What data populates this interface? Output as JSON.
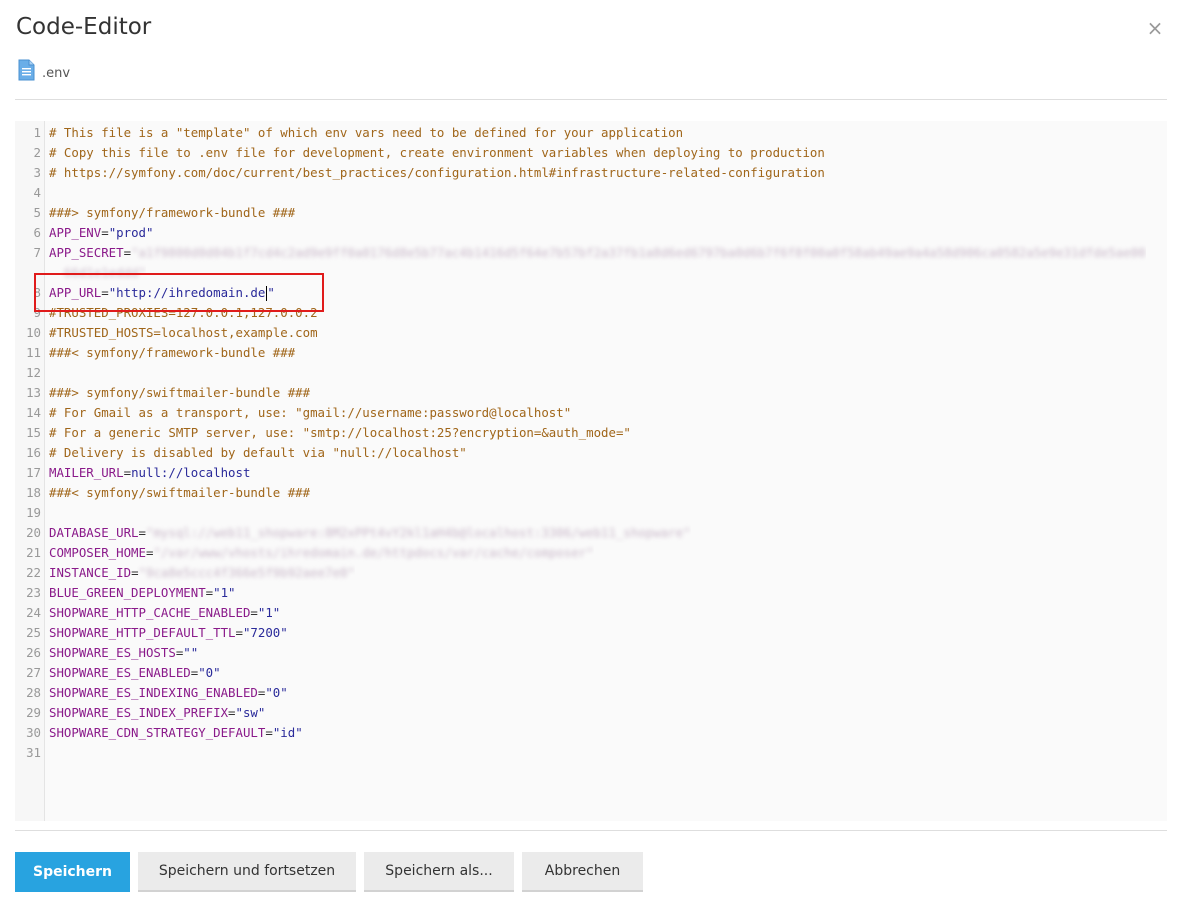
{
  "dialog": {
    "title": "Code-Editor",
    "close_glyph": "×",
    "file_name": ".env"
  },
  "editor": {
    "lines": [
      {
        "n": "1",
        "parts": [
          {
            "t": "# This file is a \"template\" of which env vars need to be defined for your application",
            "c": "cmt"
          }
        ]
      },
      {
        "n": "2",
        "parts": [
          {
            "t": "# Copy this file to .env file for development, create environment variables when deploying to production",
            "c": "cmt"
          }
        ]
      },
      {
        "n": "3",
        "parts": [
          {
            "t": "# https://symfony.com/doc/current/best_practices/configuration.html#infrastructure-related-configuration",
            "c": "cmt"
          }
        ]
      },
      {
        "n": "4",
        "parts": []
      },
      {
        "n": "5",
        "parts": [
          {
            "t": "###> symfony/framework-bundle ###",
            "c": "cmt"
          }
        ]
      },
      {
        "n": "6",
        "parts": [
          {
            "t": "APP_ENV",
            "c": "key"
          },
          {
            "t": "=",
            "c": "eq"
          },
          {
            "t": "\"prod\"",
            "c": "str"
          }
        ]
      },
      {
        "n": "7",
        "parts": [
          {
            "t": "APP_SECRET",
            "c": "key"
          },
          {
            "t": "=",
            "c": "eq"
          },
          {
            "t": "\"a1f9800d0d04b1f7cd4c2ad9e9ff0a0176d8e5b77ac4b1416d5f64e7b57bf2a37fb1a8d6ed6797ba0d6b7f6f8f00a0f58ab49ae9a4a58d906ca0582a5e9e31dfde5ae00",
            "c": "blur"
          }
        ]
      },
      {
        "n": "",
        "parts": [
          {
            "t": "  66d1e1eddd\"",
            "c": "blur"
          }
        ]
      },
      {
        "n": "8",
        "parts": [
          {
            "t": "APP_URL",
            "c": "key"
          },
          {
            "t": "=",
            "c": "eq"
          },
          {
            "t": "\"http://ihredomain.de",
            "c": "str"
          },
          {
            "t": "|CURSOR|",
            "c": "cursor"
          },
          {
            "t": "\"",
            "c": "str"
          }
        ]
      },
      {
        "n": "9",
        "parts": [
          {
            "t": "#TRUSTED_PROXIES=127.0.0.1,127.0.0.2",
            "c": "cmt"
          }
        ]
      },
      {
        "n": "10",
        "parts": [
          {
            "t": "#TRUSTED_HOSTS=localhost,example.com",
            "c": "cmt"
          }
        ]
      },
      {
        "n": "11",
        "parts": [
          {
            "t": "###< symfony/framework-bundle ###",
            "c": "cmt"
          }
        ]
      },
      {
        "n": "12",
        "parts": []
      },
      {
        "n": "13",
        "parts": [
          {
            "t": "###> symfony/swiftmailer-bundle ###",
            "c": "cmt"
          }
        ]
      },
      {
        "n": "14",
        "parts": [
          {
            "t": "# For Gmail as a transport, use: \"gmail://username:password@localhost\"",
            "c": "cmt"
          }
        ]
      },
      {
        "n": "15",
        "parts": [
          {
            "t": "# For a generic SMTP server, use: \"smtp://localhost:25?encryption=&auth_mode=\"",
            "c": "cmt"
          }
        ]
      },
      {
        "n": "16",
        "parts": [
          {
            "t": "# Delivery is disabled by default via \"null://localhost\"",
            "c": "cmt"
          }
        ]
      },
      {
        "n": "17",
        "parts": [
          {
            "t": "MAILER_URL",
            "c": "key"
          },
          {
            "t": "=",
            "c": "eq"
          },
          {
            "t": "null://localhost",
            "c": "str"
          }
        ]
      },
      {
        "n": "18",
        "parts": [
          {
            "t": "###< symfony/swiftmailer-bundle ###",
            "c": "cmt"
          }
        ]
      },
      {
        "n": "19",
        "parts": []
      },
      {
        "n": "20",
        "parts": [
          {
            "t": "DATABASE_URL",
            "c": "key"
          },
          {
            "t": "=",
            "c": "eq"
          },
          {
            "t": "\"mysql://web11_shopware:8M2xPPt4vY2kl1aH4b@localhost:3306/web11_shopware\"",
            "c": "blur"
          }
        ]
      },
      {
        "n": "21",
        "parts": [
          {
            "t": "COMPOSER_HOME",
            "c": "key"
          },
          {
            "t": "=",
            "c": "eq"
          },
          {
            "t": "\"/var/www/vhosts/ihredomain.de/httpdocs/var/cache/composer\"",
            "c": "blur"
          }
        ]
      },
      {
        "n": "22",
        "parts": [
          {
            "t": "INSTANCE_ID",
            "c": "key"
          },
          {
            "t": "=",
            "c": "eq"
          },
          {
            "t": "\"9ca8e5ccc4f366e5f9b92aee7e0\"",
            "c": "blur"
          }
        ]
      },
      {
        "n": "23",
        "parts": [
          {
            "t": "BLUE_GREEN_DEPLOYMENT",
            "c": "key"
          },
          {
            "t": "=",
            "c": "eq"
          },
          {
            "t": "\"1\"",
            "c": "str"
          }
        ]
      },
      {
        "n": "24",
        "parts": [
          {
            "t": "SHOPWARE_HTTP_CACHE_ENABLED",
            "c": "key"
          },
          {
            "t": "=",
            "c": "eq"
          },
          {
            "t": "\"1\"",
            "c": "str"
          }
        ]
      },
      {
        "n": "25",
        "parts": [
          {
            "t": "SHOPWARE_HTTP_DEFAULT_TTL",
            "c": "key"
          },
          {
            "t": "=",
            "c": "eq"
          },
          {
            "t": "\"7200\"",
            "c": "str"
          }
        ]
      },
      {
        "n": "26",
        "parts": [
          {
            "t": "SHOPWARE_ES_HOSTS",
            "c": "key"
          },
          {
            "t": "=",
            "c": "eq"
          },
          {
            "t": "\"\"",
            "c": "str"
          }
        ]
      },
      {
        "n": "27",
        "parts": [
          {
            "t": "SHOPWARE_ES_ENABLED",
            "c": "key"
          },
          {
            "t": "=",
            "c": "eq"
          },
          {
            "t": "\"0\"",
            "c": "str"
          }
        ]
      },
      {
        "n": "28",
        "parts": [
          {
            "t": "SHOPWARE_ES_INDEXING_ENABLED",
            "c": "key"
          },
          {
            "t": "=",
            "c": "eq"
          },
          {
            "t": "\"0\"",
            "c": "str"
          }
        ]
      },
      {
        "n": "29",
        "parts": [
          {
            "t": "SHOPWARE_ES_INDEX_PREFIX",
            "c": "key"
          },
          {
            "t": "=",
            "c": "eq"
          },
          {
            "t": "\"sw\"",
            "c": "str"
          }
        ]
      },
      {
        "n": "30",
        "parts": [
          {
            "t": "SHOPWARE_CDN_STRATEGY_DEFAULT",
            "c": "key"
          },
          {
            "t": "=",
            "c": "eq"
          },
          {
            "t": "\"id\"",
            "c": "str"
          }
        ]
      },
      {
        "n": "31",
        "parts": []
      }
    ]
  },
  "buttons": {
    "save": "Speichern",
    "save_continue": "Speichern und fortsetzen",
    "save_as": "Speichern als...",
    "cancel": "Abbrechen"
  },
  "colors": {
    "primary": "#28a3e0",
    "highlight_box": "#e01b1b",
    "comment": "#a0661a",
    "key": "#8a1a8a"
  },
  "icons": {
    "close": "close-icon",
    "file": "file-text-icon"
  }
}
